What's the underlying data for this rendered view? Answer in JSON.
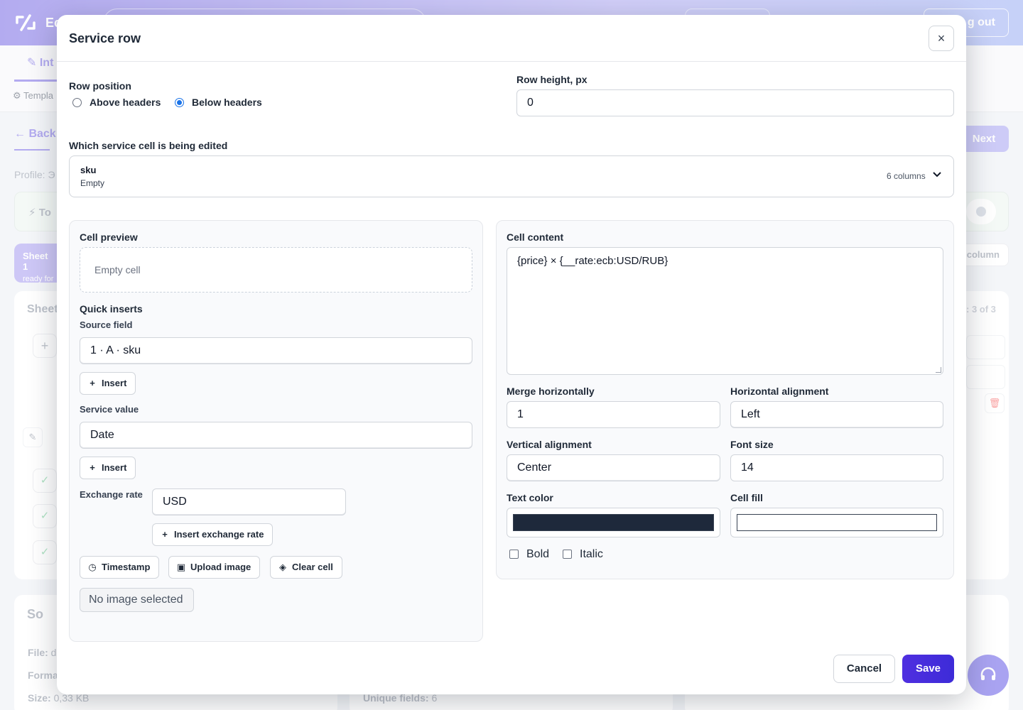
{
  "background": {
    "brand": "Ec",
    "logout": "g out",
    "tab": "Int",
    "templates": "Templa",
    "back": "Back",
    "next": "Next",
    "profile": "Profile: Э",
    "banner": "To",
    "sheet_title": "Sheet 1",
    "sheet_status": "ready for",
    "card_title": "Sheet",
    "column_btn": "column",
    "pagination": ": 3 of 3",
    "file_title": "So",
    "file_label": "File:",
    "file_value": "d",
    "format_label": "Forma",
    "size_label": "Size:",
    "size_value": "0,33 KB",
    "unique_label": "Unique fields:",
    "unique_value": "6"
  },
  "modal": {
    "title": "Service row",
    "close": "×",
    "row_position": {
      "label": "Row position",
      "options": [
        "Above headers",
        "Below headers"
      ],
      "selected": "Below headers"
    },
    "row_height": {
      "label": "Row height, px",
      "value": "0"
    },
    "cell_select": {
      "label": "Which service cell is being edited",
      "name": "sku",
      "status": "Empty",
      "count": "6 columns"
    },
    "left": {
      "preview_label": "Cell preview",
      "preview_text": "Empty cell",
      "quick_inserts": "Quick inserts",
      "source_field_label": "Source field",
      "source_field_value": "1 · A · sku",
      "insert": "Insert",
      "service_value_label": "Service value",
      "service_value": "Date",
      "exchange_label": "Exchange rate",
      "exchange_value": "USD",
      "insert_rate": "Insert exchange rate",
      "timestamp": "Timestamp",
      "upload_image": "Upload image",
      "clear_cell": "Clear cell",
      "no_image": "No image selected"
    },
    "right": {
      "content_label": "Cell content",
      "content_value": "{price} × {__rate:ecb:USD/RUB}",
      "merge_label": "Merge horizontally",
      "merge_value": "1",
      "halign_label": "Horizontal alignment",
      "halign_value": "Left",
      "valign_label": "Vertical alignment",
      "valign_value": "Center",
      "font_size_label": "Font size",
      "font_size_value": "14",
      "text_color_label": "Text color",
      "text_color": "#1e293b",
      "fill_label": "Cell fill",
      "fill_color": "#ffffff",
      "bold": "Bold",
      "italic": "Italic"
    },
    "cancel": "Cancel",
    "save": "Save"
  }
}
